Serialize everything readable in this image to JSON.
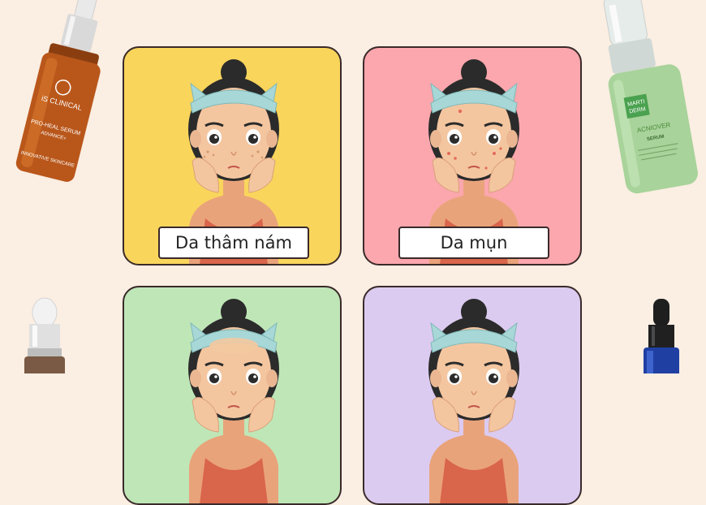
{
  "background": "#fbeee2",
  "cards": [
    {
      "label": "Da thâm nám",
      "color": "#f9d55c"
    },
    {
      "label": "Da mụn",
      "color": "#fba7ad"
    },
    {
      "label": "",
      "color": "#bfe6b7"
    },
    {
      "label": "",
      "color": "#dccbf0"
    }
  ],
  "products": {
    "left_top": {
      "brand": "iS CLINICAL",
      "name": "PRO-HEAL SERUM",
      "variant": "ADVANCE+",
      "tagline": "INNOVATIVE SKINCARE"
    },
    "right_top": {
      "brand_line1": "MARTI",
      "brand_line2": "DERM",
      "name": "ACNIOVER",
      "type": "SERUM"
    }
  }
}
